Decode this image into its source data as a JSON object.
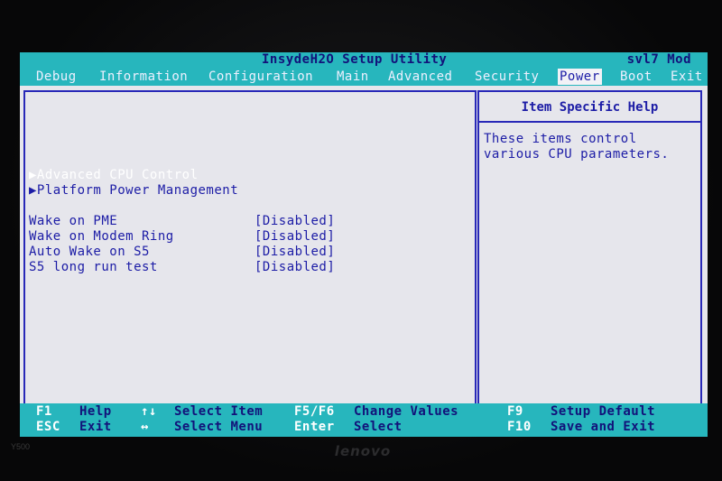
{
  "window": {
    "title": "InsydeH2O Setup Utility",
    "model": "svl7 Mod"
  },
  "menu": {
    "items": [
      {
        "label": "Debug",
        "active": false
      },
      {
        "label": "Information",
        "active": false
      },
      {
        "label": "Configuration",
        "active": false
      },
      {
        "label": "Main",
        "active": false
      },
      {
        "label": "Advanced",
        "active": false
      },
      {
        "label": "Security",
        "active": false
      },
      {
        "label": "Power",
        "active": true
      },
      {
        "label": "Boot",
        "active": false
      },
      {
        "label": "Exit",
        "active": false
      }
    ]
  },
  "main": {
    "submenus": [
      {
        "label": "▶Advanced CPU Control",
        "selected": true
      },
      {
        "label": "▶Platform Power Management",
        "selected": false
      }
    ],
    "settings": [
      {
        "label": "Wake on PME",
        "value": "[Disabled]"
      },
      {
        "label": "Wake on Modem Ring",
        "value": "[Disabled]"
      },
      {
        "label": "Auto Wake on S5",
        "value": "[Disabled]"
      },
      {
        "label": "S5 long run test",
        "value": "[Disabled]"
      }
    ]
  },
  "help": {
    "title": "Item Specific Help",
    "text": "These items control\nvarious CPU parameters."
  },
  "footer": {
    "keys": [
      {
        "key": "F1",
        "desc": "Help"
      },
      {
        "key": "ESC",
        "desc": "Exit"
      },
      {
        "key": "↑↓",
        "desc": "Select Item"
      },
      {
        "key": "↔",
        "desc": "Select Menu"
      },
      {
        "key": "F5/F6",
        "desc": "Change Values"
      },
      {
        "key": "Enter",
        "desc": "Select"
      },
      {
        "key": "F9",
        "desc": "Setup Default"
      },
      {
        "key": "F10",
        "desc": "Save and Exit"
      }
    ]
  },
  "bezel": {
    "brand": "lenovo",
    "model": "Y500"
  },
  "colors": {
    "screen_bg": "#e6e6ec",
    "bar_bg": "#27b6bd",
    "text_blue": "#1c1ca6",
    "border_blue": "#2828b8",
    "highlight": "#ffffff"
  }
}
